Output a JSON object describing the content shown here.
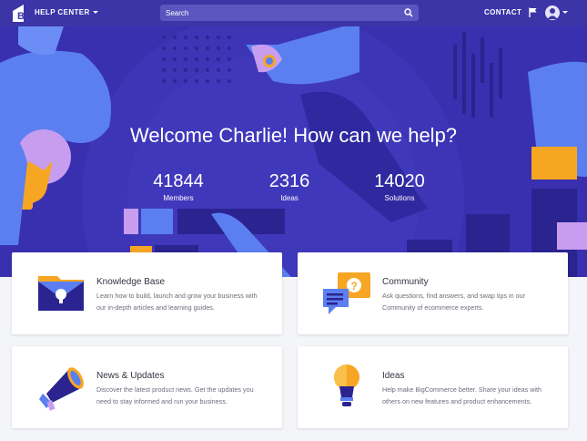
{
  "header": {
    "help_center_label": "HELP CENTER",
    "search_placeholder": "Search",
    "contact_label": "CONTACT"
  },
  "hero": {
    "welcome": "Welcome Charlie! How can we help?",
    "stats": [
      {
        "value": "41844",
        "label": "Members"
      },
      {
        "value": "2316",
        "label": "Ideas"
      },
      {
        "value": "14020",
        "label": "Solutions"
      }
    ]
  },
  "cards": [
    {
      "title": "Knowledge Base",
      "desc": "Learn how to build, launch and grow your business with our in-depth articles and learning guides.",
      "icon": "folder-lightbulb-icon"
    },
    {
      "title": "Community",
      "desc": "Ask questions, find answers, and swap tips in our Community of ecommerce experts.",
      "icon": "chat-bubbles-icon"
    },
    {
      "title": "News & Updates",
      "desc": "Discover the latest product news. Get the updates you need to stay informed and run your business.",
      "icon": "megaphone-icon"
    },
    {
      "title": "Ideas",
      "desc": "Help make BigCommerce better. Share your ideas with others on new features and product enhancements.",
      "icon": "lightbulb-icon"
    }
  ],
  "colors": {
    "topbar": "#3b35a8",
    "hero": "#3930b0",
    "accent_orange": "#f6a623",
    "accent_blue": "#5b7ff0"
  }
}
